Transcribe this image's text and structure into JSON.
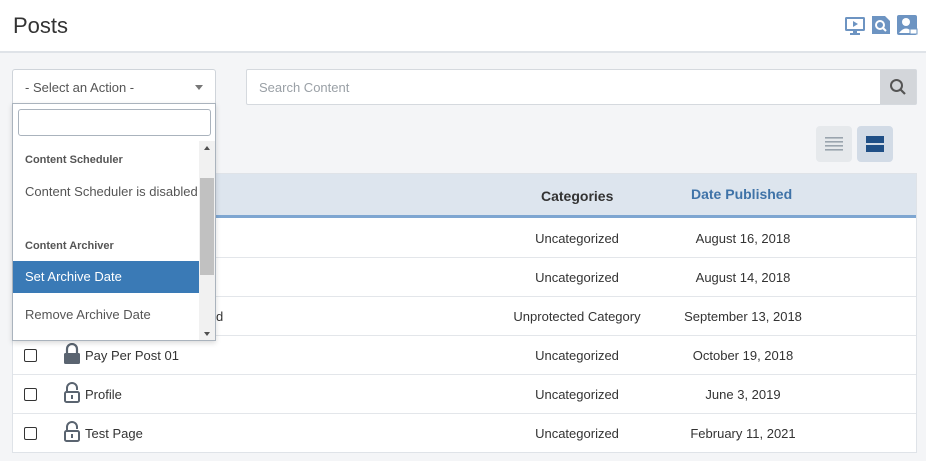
{
  "header": {
    "title": "Posts",
    "icons": [
      "video-tutorial-icon",
      "search-content-icon",
      "user-profile-icon"
    ]
  },
  "toolbar": {
    "action_select_value": "- Select an Action -",
    "search_placeholder": "Search Content",
    "search_value": ""
  },
  "dropdown": {
    "search_value": "",
    "groups": [
      {
        "label": "Content Scheduler",
        "items": [
          {
            "label": "Content Scheduler is disabled",
            "disabled": true
          }
        ]
      },
      {
        "label": "Content Archiver",
        "items": [
          {
            "label": "Set Archive Date",
            "highlighted": true
          },
          {
            "label": "Remove Archive Date"
          }
        ]
      }
    ]
  },
  "table": {
    "columns": [
      "Categories",
      "Date Published"
    ],
    "rows": [
      {
        "title": "",
        "category": "Uncategorized",
        "date": "August 16, 2018",
        "locked": false
      },
      {
        "title": "",
        "category": "Uncategorized",
        "date": "August 14, 2018",
        "locked": false
      },
      {
        "title": "d",
        "category": "Unprotected Category",
        "date": "September 13, 2018",
        "locked": false
      },
      {
        "title": "Pay Per Post 01",
        "category": "Uncategorized",
        "date": "October 19, 2018",
        "locked": true
      },
      {
        "title": "Profile",
        "category": "Uncategorized",
        "date": "June 3, 2019",
        "locked": false
      },
      {
        "title": "Test Page",
        "category": "Uncategorized",
        "date": "February 11, 2021",
        "locked": false
      }
    ]
  },
  "colors": {
    "accent": "#3a7ab6",
    "header_link": "#3f73a8",
    "table_header_bg": "#dde5ee",
    "table_header_border": "#7ea6d1"
  }
}
